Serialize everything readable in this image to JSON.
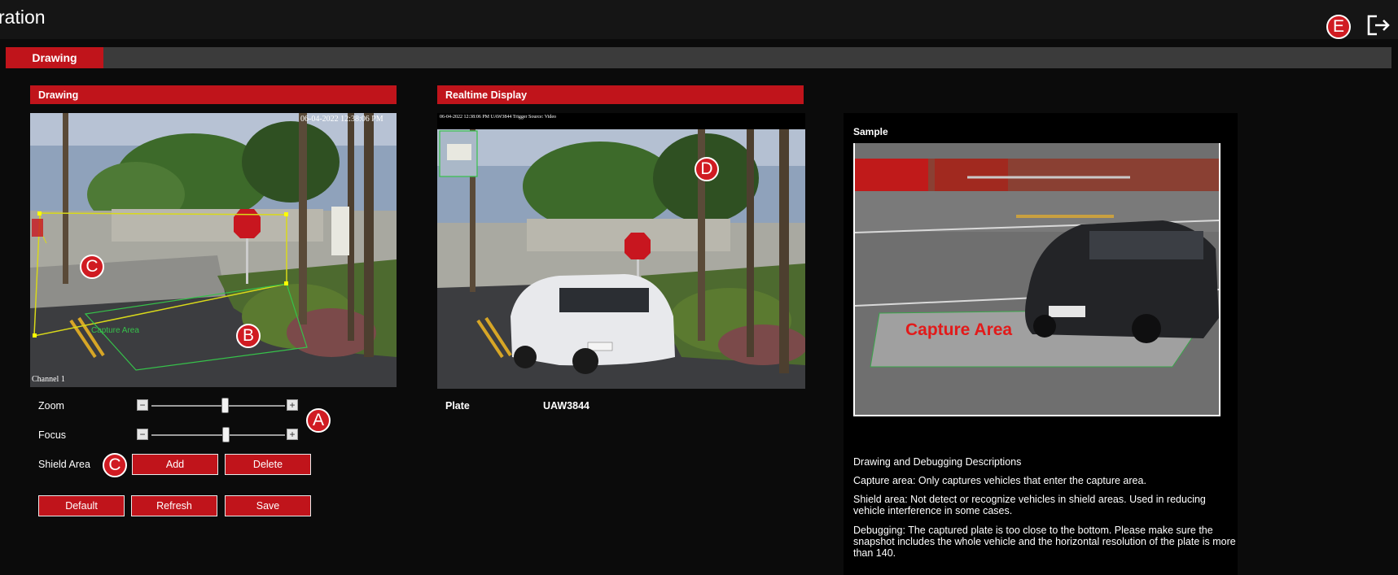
{
  "header": {
    "title": "ration"
  },
  "tabs": [
    {
      "label": "Drawing"
    }
  ],
  "drawing_panel": {
    "title": "Drawing",
    "timestamp": "06-04-2022 12:38:06 PM",
    "channel": "Channel 1",
    "capture_label": "Capture Area",
    "zoom_label": "Zoom",
    "focus_label": "Focus",
    "zoom_value": 0.55,
    "focus_value": 0.56,
    "shield_label": "Shield Area",
    "add_label": "Add",
    "delete_label": "Delete",
    "default_label": "Default",
    "refresh_label": "Refresh",
    "save_label": "Save"
  },
  "realtime_panel": {
    "title": "Realtime Display",
    "overlay_text": "06-04-2022 12:38:06 PM UAW3844 Trigger Source: Video",
    "plate_label": "Plate",
    "plate_value": "UAW3844"
  },
  "sample_panel": {
    "title": "Sample",
    "capture_label": "Capture Area",
    "desc_title": "Drawing and Debugging Descriptions",
    "desc_capture": "Capture area: Only captures vehicles that enter the capture area.",
    "desc_shield": "Shield area: Not detect or recognize vehicles in shield areas. Used in reducing vehicle interference in some cases.",
    "desc_debug": "Debugging: The captured plate is too close to the bottom. Please make sure the snapshot includes the whole vehicle and the horizontal resolution of the plate is more than 140."
  },
  "markers": {
    "a": "A",
    "b": "B",
    "c": "C",
    "d": "D",
    "e": "E"
  },
  "colors": {
    "accent": "#c0141b",
    "background": "#0b0b0b",
    "capture_line": "#d9d91a",
    "shield_line": "#36c24a"
  },
  "icons": {
    "logout": "logout-icon"
  }
}
